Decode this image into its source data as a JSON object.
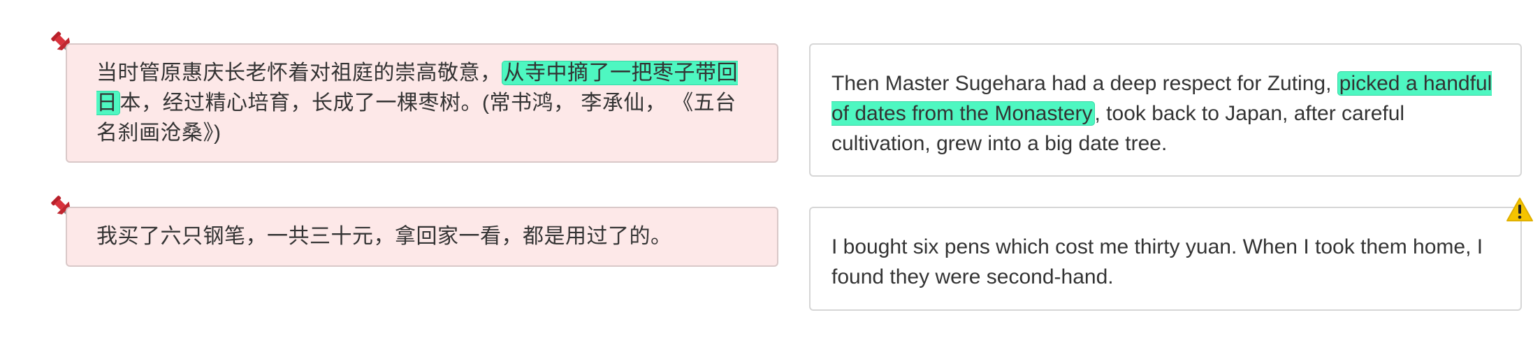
{
  "rows": [
    {
      "source": {
        "before": "当时管原惠庆长老怀着对祖庭的崇高敬意，",
        "highlight": "从寺中摘了一把枣子带回日",
        "after": "本，经过精心培育，长成了一棵枣树。(常书鸿， 李承仙， 《五台名刹画沧桑》)"
      },
      "target": {
        "before": "Then Master Sugehara had a deep respect for Zuting, ",
        "highlight": "picked a handful of dates from the Monastery",
        "after": ", took back to Japan, after careful cultivation, grew into a big date tree."
      },
      "pinned": true,
      "warning": false
    },
    {
      "source": {
        "before": "我买了六只钢笔，一共三十元，拿回家一看，都是用过了的。",
        "highlight": "",
        "after": ""
      },
      "target": {
        "before": "I bought six pens which cost me thirty yuan. When I took them home, I found they were second-hand.",
        "highlight": "",
        "after": ""
      },
      "pinned": true,
      "warning": true
    }
  ],
  "colors": {
    "source_bg": "#fde8e8",
    "highlight": "#4ef7c1",
    "warning": "#f5c400"
  },
  "icons": {
    "pin": "pushpin-icon",
    "warning": "warning-icon"
  }
}
